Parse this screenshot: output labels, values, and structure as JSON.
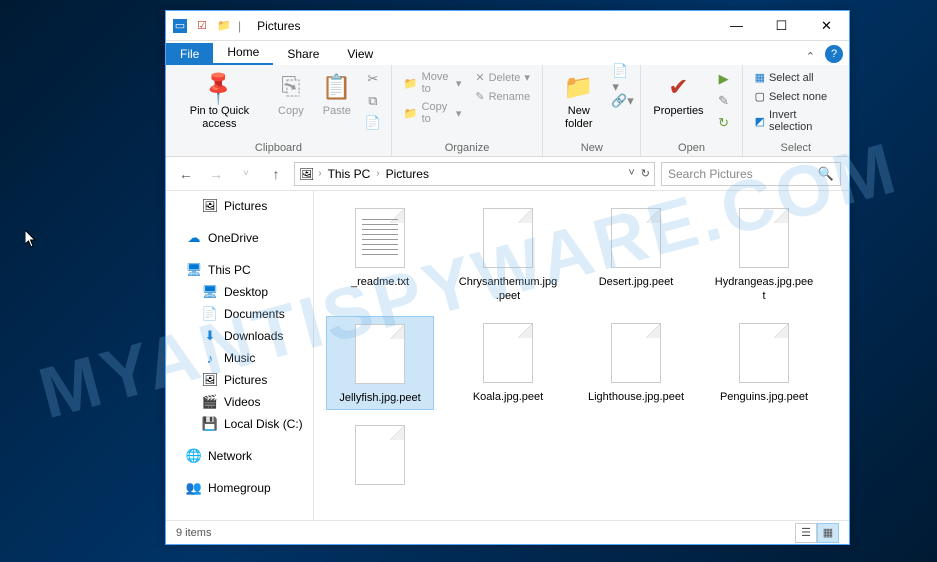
{
  "window": {
    "title": "Pictures",
    "minimize": "—",
    "maximize": "☐",
    "close": "✕"
  },
  "ribbon_tabs": {
    "file": "File",
    "home": "Home",
    "share": "Share",
    "view": "View"
  },
  "ribbon": {
    "clipboard": {
      "label": "Clipboard",
      "pin": "Pin to Quick access",
      "copy": "Copy",
      "paste": "Paste"
    },
    "organize": {
      "label": "Organize",
      "move_to": "Move to",
      "copy_to": "Copy to",
      "delete": "Delete",
      "rename": "Rename"
    },
    "new": {
      "label": "New",
      "new_folder": "New folder"
    },
    "open": {
      "label": "Open",
      "properties": "Properties"
    },
    "select": {
      "label": "Select",
      "select_all": "Select all",
      "select_none": "Select none",
      "invert": "Invert selection"
    }
  },
  "address": {
    "crumb1": "This PC",
    "crumb2": "Pictures"
  },
  "search": {
    "placeholder": "Search Pictures"
  },
  "nav": {
    "pictures": "Pictures",
    "onedrive": "OneDrive",
    "this_pc": "This PC",
    "desktop": "Desktop",
    "documents": "Documents",
    "downloads": "Downloads",
    "music": "Music",
    "pictures2": "Pictures",
    "videos": "Videos",
    "local_disk": "Local Disk (C:)",
    "network": "Network",
    "homegroup": "Homegroup"
  },
  "files": [
    {
      "name": "_readme.txt",
      "type": "txt"
    },
    {
      "name": "Chrysanthemum.jpg.peet",
      "type": "peet"
    },
    {
      "name": "Desert.jpg.peet",
      "type": "peet"
    },
    {
      "name": "Hydrangeas.jpg.peet",
      "type": "peet"
    },
    {
      "name": "Jellyfish.jpg.peet",
      "type": "peet",
      "selected": true
    },
    {
      "name": "Koala.jpg.peet",
      "type": "peet"
    },
    {
      "name": "Lighthouse.jpg.peet",
      "type": "peet"
    },
    {
      "name": "Penguins.jpg.peet",
      "type": "peet"
    },
    {
      "name": "",
      "type": "peet"
    }
  ],
  "status": {
    "items": "9 items"
  }
}
